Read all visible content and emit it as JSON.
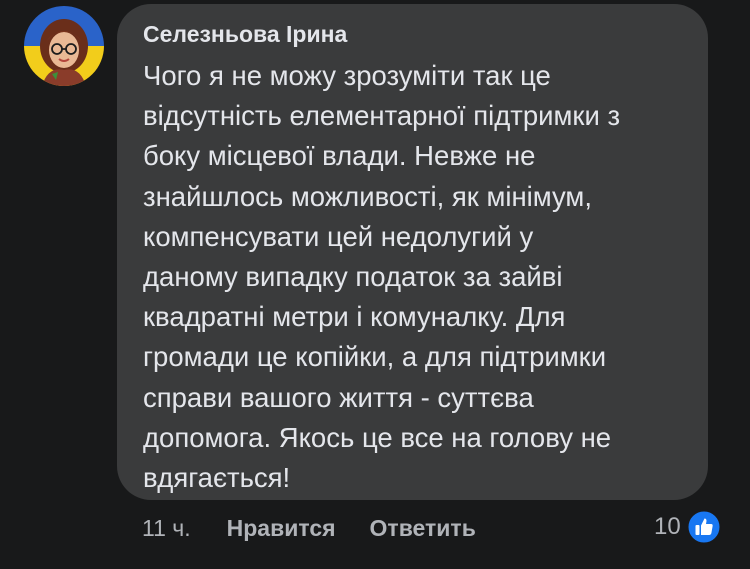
{
  "comment": {
    "author": "Селезньова Ірина",
    "text": "Чого я не можу зрозуміти так це\nвідсутність елементарної підтримки з\nбоку місцевої влади. Невже не\nзнайшлось можливості, як мінімум,\nкомпенсувати цей недолугий у\nданому випадку податок за зайві\nквадратні метри і комуналку. Для\nгромади це копійки, а для підтримки\nсправи вашого життя - суттєва\nдопомога. Якось це все на голову не\nвдягається!",
    "time": "11 ч.",
    "like_label": "Нравится",
    "reply_label": "Ответить",
    "reaction_count": "10",
    "reaction_icon": "like-icon"
  },
  "colors": {
    "background": "#18191a",
    "bubble": "#3a3b3c",
    "text": "#e4e6eb",
    "secondary_text": "#b0b3b8",
    "like_blue": "#1877f2"
  }
}
